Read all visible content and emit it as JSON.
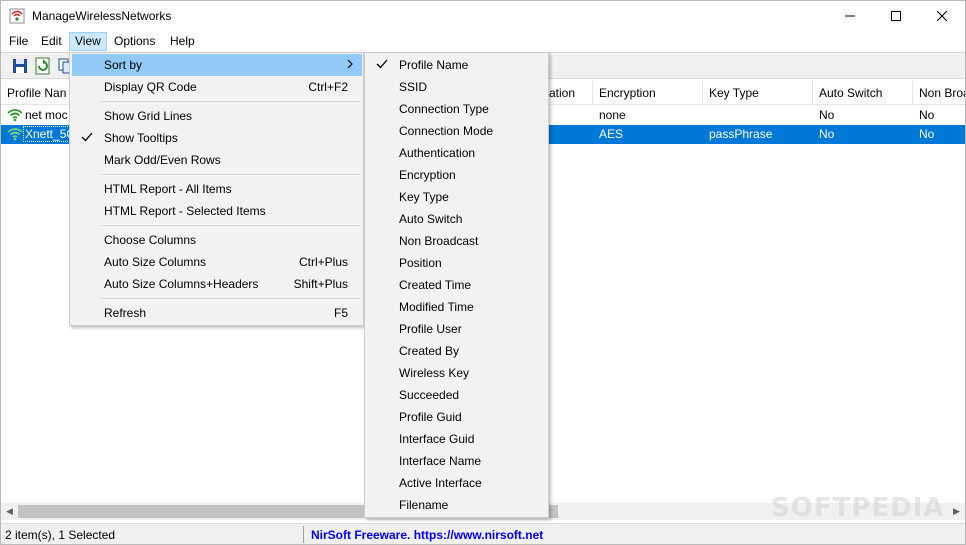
{
  "window": {
    "title": "ManageWirelessNetworks"
  },
  "colors": {
    "selection": "#0078d7",
    "menu_highlight": "#91c9f7",
    "link": "#0000ff"
  },
  "menubar": {
    "items": [
      "File",
      "Edit",
      "View",
      "Options",
      "Help"
    ],
    "active": "View"
  },
  "toolbar": {
    "icons": [
      "save-icon",
      "refresh-icon",
      "copy-icon"
    ]
  },
  "list": {
    "columns": [
      "Profile Name",
      "SSID",
      "Connection Type",
      "Connection Mode",
      "Authentication",
      "Encryption",
      "Key Type",
      "Auto Switch",
      "Non Broadcast"
    ],
    "visible_headers": {
      "profile_name": "Profile Nan",
      "auth_tail": "ation",
      "encryption": "Encryption",
      "key_type": "Key Type",
      "auto_switch": "Auto Switch",
      "non_broadcast": "Non Broa"
    },
    "rows": [
      {
        "profile_name": "net moc",
        "encryption": "none",
        "key_type": "",
        "auto_switch": "No",
        "non_broadcast": "No",
        "selected": false
      },
      {
        "profile_name": "Xnett_5G",
        "encryption": "AES",
        "key_type": "passPhrase",
        "auto_switch": "No",
        "non_broadcast": "No",
        "selected": true
      }
    ]
  },
  "view_menu": {
    "items": [
      {
        "label": "Sort by",
        "shortcut": "",
        "checked": false,
        "submenu": true,
        "highlighted": true
      },
      {
        "label": "Display QR Code",
        "shortcut": "Ctrl+F2",
        "checked": false
      },
      {
        "label": "Show Grid Lines",
        "shortcut": "",
        "checked": false
      },
      {
        "label": "Show Tooltips",
        "shortcut": "",
        "checked": true
      },
      {
        "label": "Mark Odd/Even Rows",
        "shortcut": "",
        "checked": false
      },
      {
        "label": "HTML Report - All Items",
        "shortcut": "",
        "checked": false
      },
      {
        "label": "HTML Report - Selected Items",
        "shortcut": "",
        "checked": false
      },
      {
        "label": "Choose Columns",
        "shortcut": "",
        "checked": false
      },
      {
        "label": "Auto Size Columns",
        "shortcut": "Ctrl+Plus",
        "checked": false
      },
      {
        "label": "Auto Size Columns+Headers",
        "shortcut": "Shift+Plus",
        "checked": false
      },
      {
        "label": "Refresh",
        "shortcut": "F5",
        "checked": false
      }
    ]
  },
  "sort_menu": {
    "checked_item": "Profile Name",
    "items": [
      "Profile Name",
      "SSID",
      "Connection Type",
      "Connection Mode",
      "Authentication",
      "Encryption",
      "Key Type",
      "Auto Switch",
      "Non Broadcast",
      "Position",
      "Created Time",
      "Modified Time",
      "Profile User",
      "Created By",
      "Wireless Key",
      "Succeeded",
      "Profile Guid",
      "Interface Guid",
      "Interface Name",
      "Active Interface",
      "Filename"
    ]
  },
  "statusbar": {
    "left": "2 item(s), 1 Selected",
    "right": "NirSoft Freeware. https://www.nirsoft.net"
  },
  "watermark": "SOFTPEDIA"
}
